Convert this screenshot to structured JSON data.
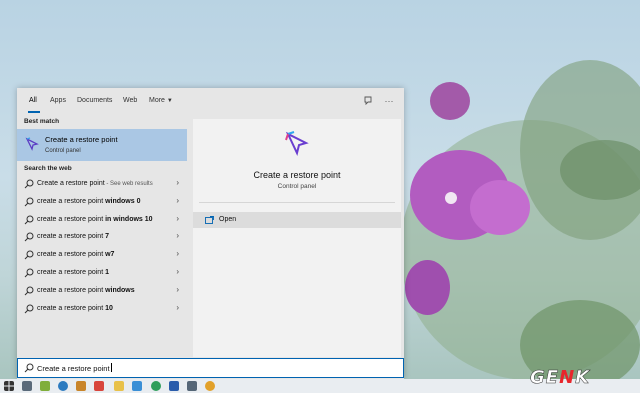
{
  "tabs": [
    {
      "label": "All",
      "active": true
    },
    {
      "label": "Apps"
    },
    {
      "label": "Documents"
    },
    {
      "label": "Web"
    },
    {
      "label": "More",
      "has_dropdown": true
    }
  ],
  "tab_icons": [
    "feedback-icon",
    "more-options-icon"
  ],
  "left": {
    "best_match_label": "Best match",
    "best_match": {
      "title": "Create a restore point",
      "subtitle": "Control panel",
      "icon": "restore-point-icon"
    },
    "web_label": "Search the web",
    "web_results": [
      {
        "prefix": "Create a restore point",
        "bold": "",
        "suffix": " - See web results"
      },
      {
        "prefix": "create a restore point ",
        "bold": "windows 0",
        "suffix": ""
      },
      {
        "prefix": "create a restore point ",
        "bold": "in windows 10",
        "suffix": ""
      },
      {
        "prefix": "create a restore point ",
        "bold": "7",
        "suffix": ""
      },
      {
        "prefix": "create a restore point ",
        "bold": "w7",
        "suffix": ""
      },
      {
        "prefix": "create a restore point ",
        "bold": "1",
        "suffix": ""
      },
      {
        "prefix": "create a restore point ",
        "bold": "windows",
        "suffix": ""
      },
      {
        "prefix": "create a restore point ",
        "bold": "10",
        "suffix": ""
      }
    ]
  },
  "right": {
    "title": "Create a restore point",
    "subtitle": "Control panel",
    "open_label": "Open"
  },
  "search": {
    "value": "Create a restore point"
  },
  "watermark": "GENK",
  "colors": {
    "accent": "#0063b1",
    "selected": "#aac7e4",
    "logo_red": "#e8262b"
  }
}
